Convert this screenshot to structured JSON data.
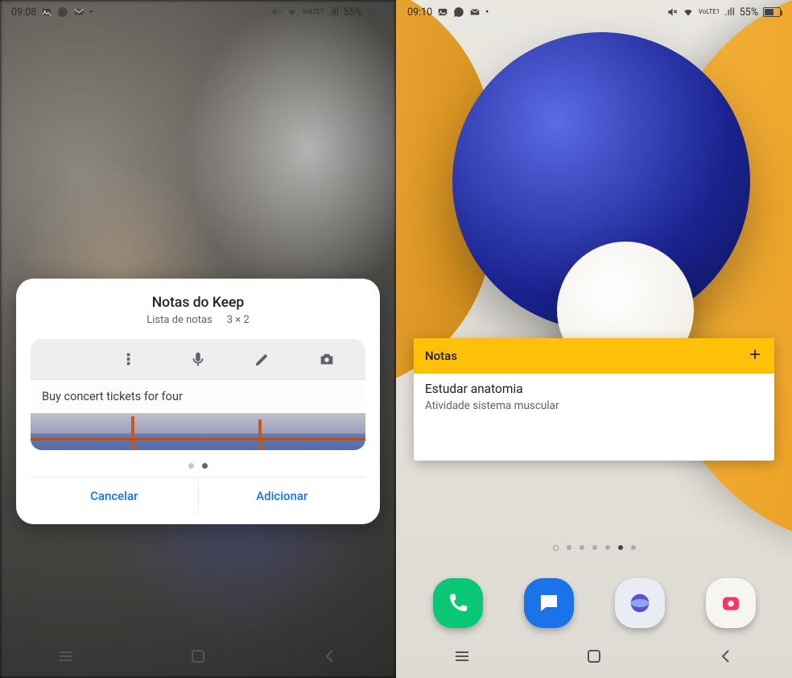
{
  "left": {
    "status": {
      "time": "09:08",
      "battery": "55%",
      "carrier": "VoLTE1",
      "signal_text": ".ıll"
    },
    "dialog": {
      "title": "Notas do Keep",
      "subtitle": "Lista de notas",
      "size": "3 × 2",
      "preview_note": "Buy concert tickets for four",
      "cancel": "Cancelar",
      "add": "Adicionar",
      "pager_active_index": 1,
      "icons": [
        "text-note-icon",
        "checklist-icon",
        "mic-icon",
        "draw-icon",
        "camera-icon"
      ]
    }
  },
  "right": {
    "status": {
      "time": "09:10",
      "battery": "55%",
      "carrier": "VoLTE1",
      "signal_text": ".ıll"
    },
    "widget": {
      "header": "Notas",
      "note_title": "Estudar anatomia",
      "note_body": "Atividade sistema muscular"
    },
    "page_indicator": {
      "count": 7,
      "active_index": 5
    },
    "dock": [
      "phone-app",
      "messages-app",
      "browser-app",
      "camera-app"
    ]
  },
  "nav": [
    "recents",
    "home",
    "back"
  ],
  "colors": {
    "accent": "#1a73e8",
    "keep_yellow": "#ffc107"
  }
}
